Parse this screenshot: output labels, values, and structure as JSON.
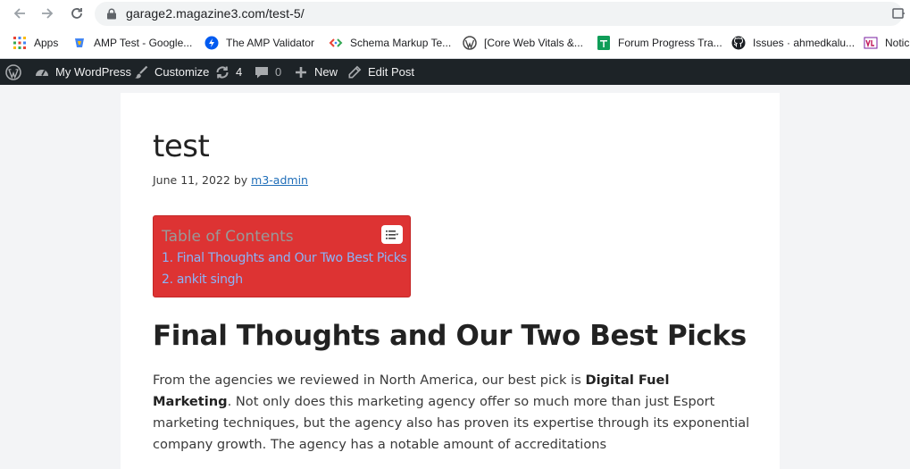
{
  "browser": {
    "url": "garage2.magazine3.com/test-5/",
    "bookmarks": [
      {
        "label": "Apps",
        "icon": "apps-grid-icon"
      },
      {
        "label": "AMP Test - Google...",
        "icon": "amp-test-icon"
      },
      {
        "label": "The AMP Validator",
        "icon": "amp-bolt-icon"
      },
      {
        "label": "Schema Markup Te...",
        "icon": "schema-markup-icon"
      },
      {
        "label": "[Core Web Vitals &...",
        "icon": "wordpress-icon"
      },
      {
        "label": "Forum Progress Tra...",
        "icon": "sheets-icon"
      },
      {
        "label": "Issues · ahmedkalu...",
        "icon": "github-icon"
      },
      {
        "label": "Notic",
        "icon": "notice-icon"
      }
    ]
  },
  "admin_bar": {
    "my_wordpress": "My WordPress",
    "customize": "Customize",
    "updates_count": "4",
    "comments_count": "0",
    "new": "New",
    "edit_post": "Edit Post"
  },
  "post": {
    "title": "test",
    "date": "June 11, 2022",
    "by": "by",
    "author": "m3-admin",
    "toc": {
      "title": "Table of Contents",
      "items": [
        "1. Final Thoughts and Our Two Best Picks",
        "2. ankit singh"
      ]
    },
    "heading": "Final Thoughts and Our Two Best Picks",
    "paragraph_before": "From the agencies we reviewed in North America, our best pick is ",
    "paragraph_bold": "Digital Fuel Marketing",
    "paragraph_after": ". Not only does this marketing agency offer so much more than just Esport marketing techniques, but the agency also has proven its expertise through its exponential company growth. The agency has a notable amount of accreditations"
  },
  "colors": {
    "toc_background": "#dd3333",
    "toc_link": "#8ab4f8",
    "admin_bar": "#1d2327",
    "page_background": "#f3f4f6"
  }
}
